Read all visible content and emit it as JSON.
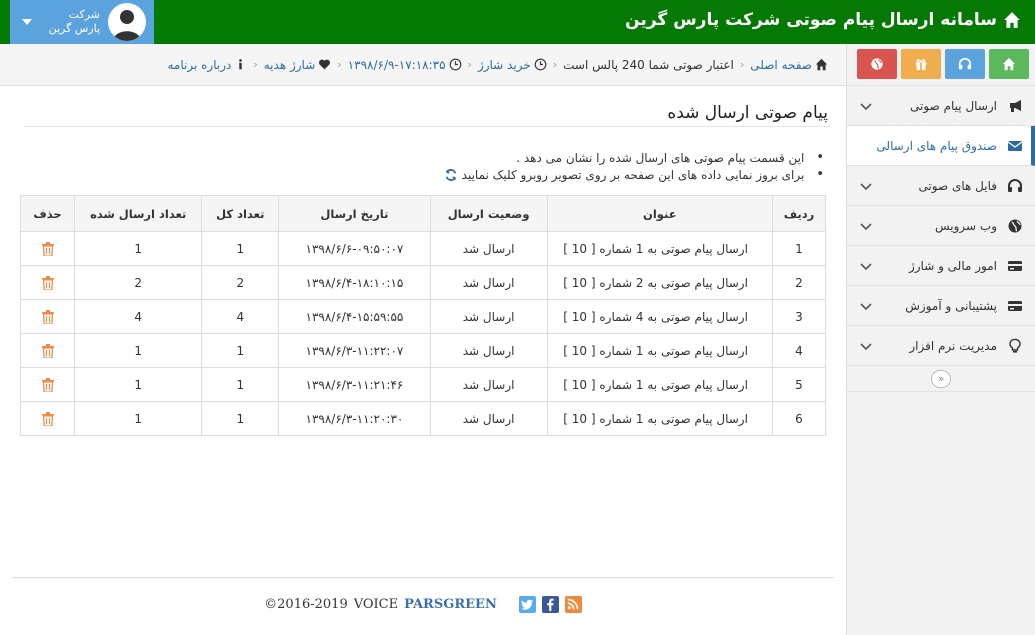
{
  "header": {
    "title": "سامانه ارسال پیام صوتی شرکت پارس گرین",
    "user_line1": "شرکت",
    "user_line2": "پارس گرین",
    "home_icon": "home-icon",
    "avatar_icon": "user-avatar-icon",
    "dropdown_icon": "caret-down-icon"
  },
  "sidebar": {
    "quick_buttons": [
      {
        "icon": "home-icon",
        "color": "#5cb85c"
      },
      {
        "icon": "headphones-icon",
        "color": "#5aa3dc"
      },
      {
        "icon": "gift-icon",
        "color": "#f0ad4e"
      },
      {
        "icon": "globe-icon",
        "color": "#d9534f"
      }
    ],
    "items": [
      {
        "label": "ارسال پیام صوتی",
        "icon": "bullhorn-icon",
        "active": false
      },
      {
        "label": "صندوق پیام های ارسالی",
        "icon": "envelope-icon",
        "active": true
      },
      {
        "label": "فایل های صوتی",
        "icon": "headphones-icon",
        "active": false
      },
      {
        "label": "وب سرویس",
        "icon": "globe-icon",
        "active": false
      },
      {
        "label": "امور مالی و شارژ",
        "icon": "credit-card-icon",
        "active": false
      },
      {
        "label": "پشتیبانی و آموزش",
        "icon": "credit-card-icon",
        "active": false
      },
      {
        "label": "مدیریت نرم افزار",
        "icon": "lightbulb-icon",
        "active": false
      }
    ],
    "collapse_label": "«"
  },
  "breadcrumb": {
    "home": "صفحه اصلی",
    "credit": "اعتبار صوتی شما 240 پالس است",
    "buy": "خرید شارژ",
    "datetime": "۱۳۹۸/۶/۹-۱۷:۱۸:۳۵",
    "gift": "شارژ هدیه",
    "about": "درباره برنامه"
  },
  "main": {
    "title": "پیام صوتی ارسال شده",
    "note1": "این قسمت پیام صوتی های ارسال شده را نشان می دهد .",
    "note2": "برای بروز نمایی داده های این صفحه بر روی تصویر روبرو کلیک نمایید"
  },
  "table": {
    "headers": [
      "ردیف",
      "عنوان",
      "وضعیت ارسال",
      "تاریخ ارسال",
      "تعداد کل",
      "تعداد ارسال شده",
      "حذف"
    ],
    "rows": [
      {
        "row": "1",
        "title": "ارسال پیام صوتی به 1 شماره [ 10 ]",
        "status": "ارسال شد",
        "date": "۱۳۹۸/۶/۶-۰۹:۵۰:۰۷",
        "total": "1",
        "sent": "1"
      },
      {
        "row": "2",
        "title": "ارسال پیام صوتی به 2 شماره [ 10 ]",
        "status": "ارسال شد",
        "date": "۱۳۹۸/۶/۴-۱۸:۱۰:۱۵",
        "total": "2",
        "sent": "2"
      },
      {
        "row": "3",
        "title": "ارسال پیام صوتی به 4 شماره [ 10 ]",
        "status": "ارسال شد",
        "date": "۱۳۹۸/۶/۴-۱۵:۵۹:۵۵",
        "total": "4",
        "sent": "4"
      },
      {
        "row": "4",
        "title": "ارسال پیام صوتی به 1 شماره [ 10 ]",
        "status": "ارسال شد",
        "date": "۱۳۹۸/۶/۳-۱۱:۲۲:۰۷",
        "total": "1",
        "sent": "1"
      },
      {
        "row": "5",
        "title": "ارسال پیام صوتی به 1 شماره [ 10 ]",
        "status": "ارسال شد",
        "date": "۱۳۹۸/۶/۳-۱۱:۲۱:۴۶",
        "total": "1",
        "sent": "1"
      },
      {
        "row": "6",
        "title": "ارسال پیام صوتی به 1 شماره [ 10 ]",
        "status": "ارسال شد",
        "date": "۱۳۹۸/۶/۳-۱۱:۲۰:۳۰",
        "total": "1",
        "sent": "1"
      }
    ],
    "delete_icon": "trash-icon",
    "delete_color": "#f08a4b"
  },
  "footer": {
    "brand": "PARSGREEN",
    "product": "VOICE",
    "copyright": "©2016-2019",
    "social": [
      "twitter-icon",
      "facebook-icon",
      "rss-icon"
    ]
  },
  "colors": {
    "topbar": "#047a04",
    "userbox": "#5aa3dc",
    "accent": "#2d6ca2"
  }
}
